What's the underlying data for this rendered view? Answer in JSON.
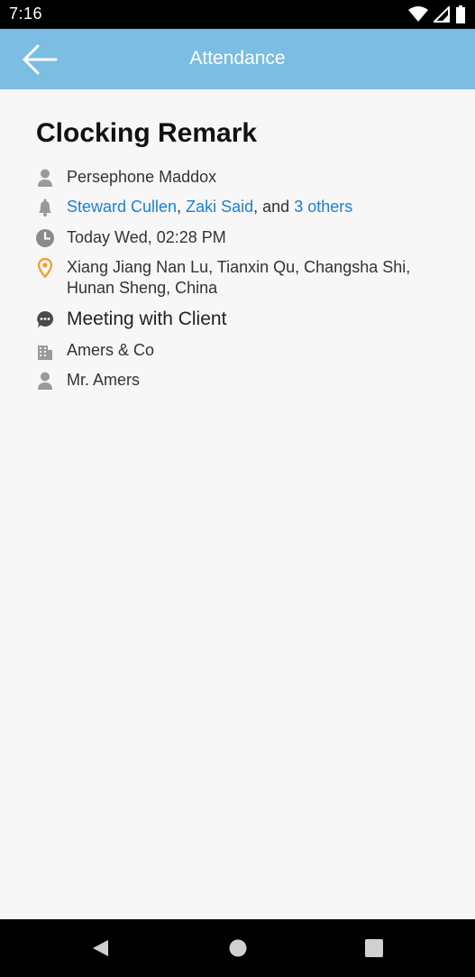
{
  "status_bar": {
    "time": "7:16",
    "icons": [
      "wifi-icon",
      "signal-icon",
      "battery-icon"
    ]
  },
  "app_bar": {
    "title": "Attendance",
    "back_icon": "back-arrow-icon",
    "color": "#7bbde3"
  },
  "remark": {
    "title": "Clocking Remark",
    "employee": "Persephone Maddox",
    "notify": {
      "person1": "Steward Cullen",
      "sep1": ",",
      "person2": "Zaki Said",
      "sep2": ", and",
      "others": "3 others"
    },
    "datetime": "Today Wed, 02:28 PM",
    "location_line1": "Xiang Jiang Nan Lu, Tianxin Qu, Changsha Shi,",
    "location_line2": "Hunan Sheng, China",
    "note": "Meeting with Client",
    "company": "Amers & Co",
    "contact": "Mr. Amers",
    "icons": [
      "person-icon",
      "bell-icon",
      "clock-icon",
      "location-pin-icon",
      "chat-bubble-icon",
      "building-icon",
      "person-icon"
    ],
    "link_color": "#1a7fd6",
    "pin_color": "#f0a030"
  },
  "nav_bar": {
    "buttons": [
      "back-triangle-icon",
      "home-circle-icon",
      "recents-square-icon"
    ]
  }
}
